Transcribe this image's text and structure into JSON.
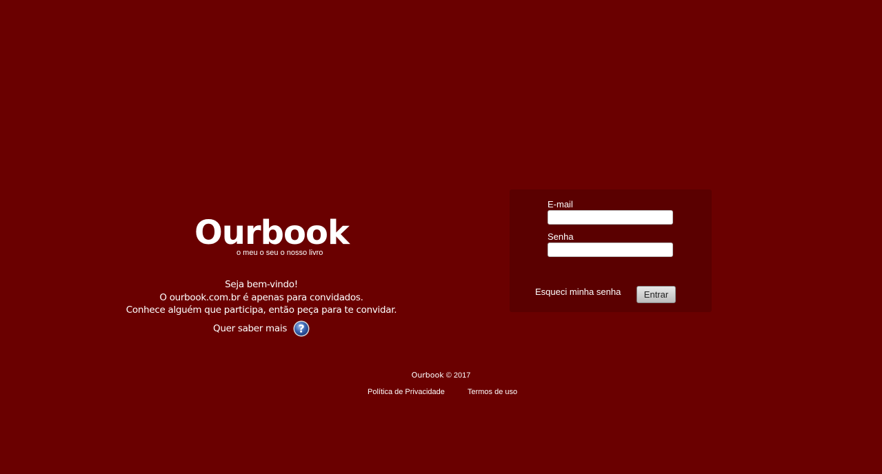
{
  "brand": {
    "logo": "Ourbook",
    "tagline": "o meu  o seu  o nosso livro"
  },
  "welcome": {
    "lines": [
      "Seja bem-vindo!",
      "O ourbook.com.br é apenas para convidados.",
      "Conhece alguém que participa, então peça para te convidar."
    ],
    "more_label": "Quer saber mais",
    "help_icon": "question-mark-circle-icon"
  },
  "login": {
    "email_label": "E-mail",
    "email_value": "",
    "password_label": "Senha",
    "password_value": "",
    "forgot_label": "Esqueci minha senha",
    "submit_label": "Entrar"
  },
  "footer": {
    "brand": "Ourbook",
    "copyright": "© 2017",
    "links": [
      "Política de Privacidade",
      "Termos de uso"
    ]
  },
  "colors": {
    "background": "#6a0000",
    "panel": "#5a0000",
    "help_icon": "#3a64b0"
  }
}
